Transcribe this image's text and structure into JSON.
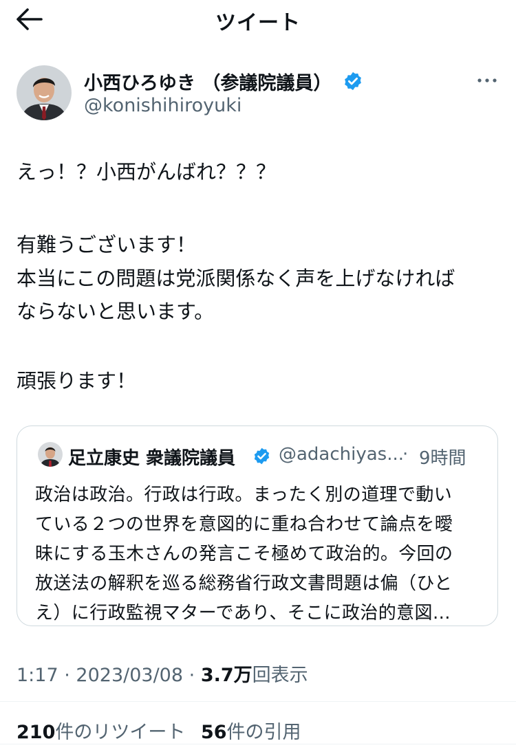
{
  "header": {
    "title": "ツイート"
  },
  "author": {
    "name": "小西ひろゆき （参議院議員）",
    "handle": "@konishihiroyuki"
  },
  "tweet": {
    "lines": [
      "えっ！？小西がんばれ？？？",
      "有難うございます！",
      "本当にこの問題は党派関係なく声を上げなければ",
      "ならないと思います。",
      "頑張ります！"
    ]
  },
  "quote": {
    "name": "足立康史 衆議院議員",
    "handle": "@adachiyas...",
    "separator": "·",
    "time": "9時間",
    "lines": [
      "政治は政治。行政は行政。まったく別の道理で動い",
      "ている２つの世界を意図的に重ね合わせて論点を曖",
      "昧にする玉木さんの発言こそ極めて政治的。今回の",
      "放送法の解釈を巡る総務省行政文書問題は偏（ひと",
      "え）に行政監視マターであり、そこに政治的意図..."
    ]
  },
  "meta": {
    "time": "1:17",
    "sep1": "·",
    "date": "2023/03/08",
    "sep2": "·",
    "views_count": "3.7万",
    "views_label": "回表示"
  },
  "stats": {
    "retweets_count": "210",
    "retweets_label": "件のリツイート",
    "quotes_count": "56",
    "quotes_label": "件の引用"
  },
  "colors": {
    "text": "#0f1419",
    "secondary": "#536471",
    "verified": "#1d9bf0",
    "border": "#cfd9de"
  },
  "icons": {
    "back": "arrow-left-icon",
    "verified": "verified-badge-icon",
    "more": "more-horizontal-icon"
  }
}
